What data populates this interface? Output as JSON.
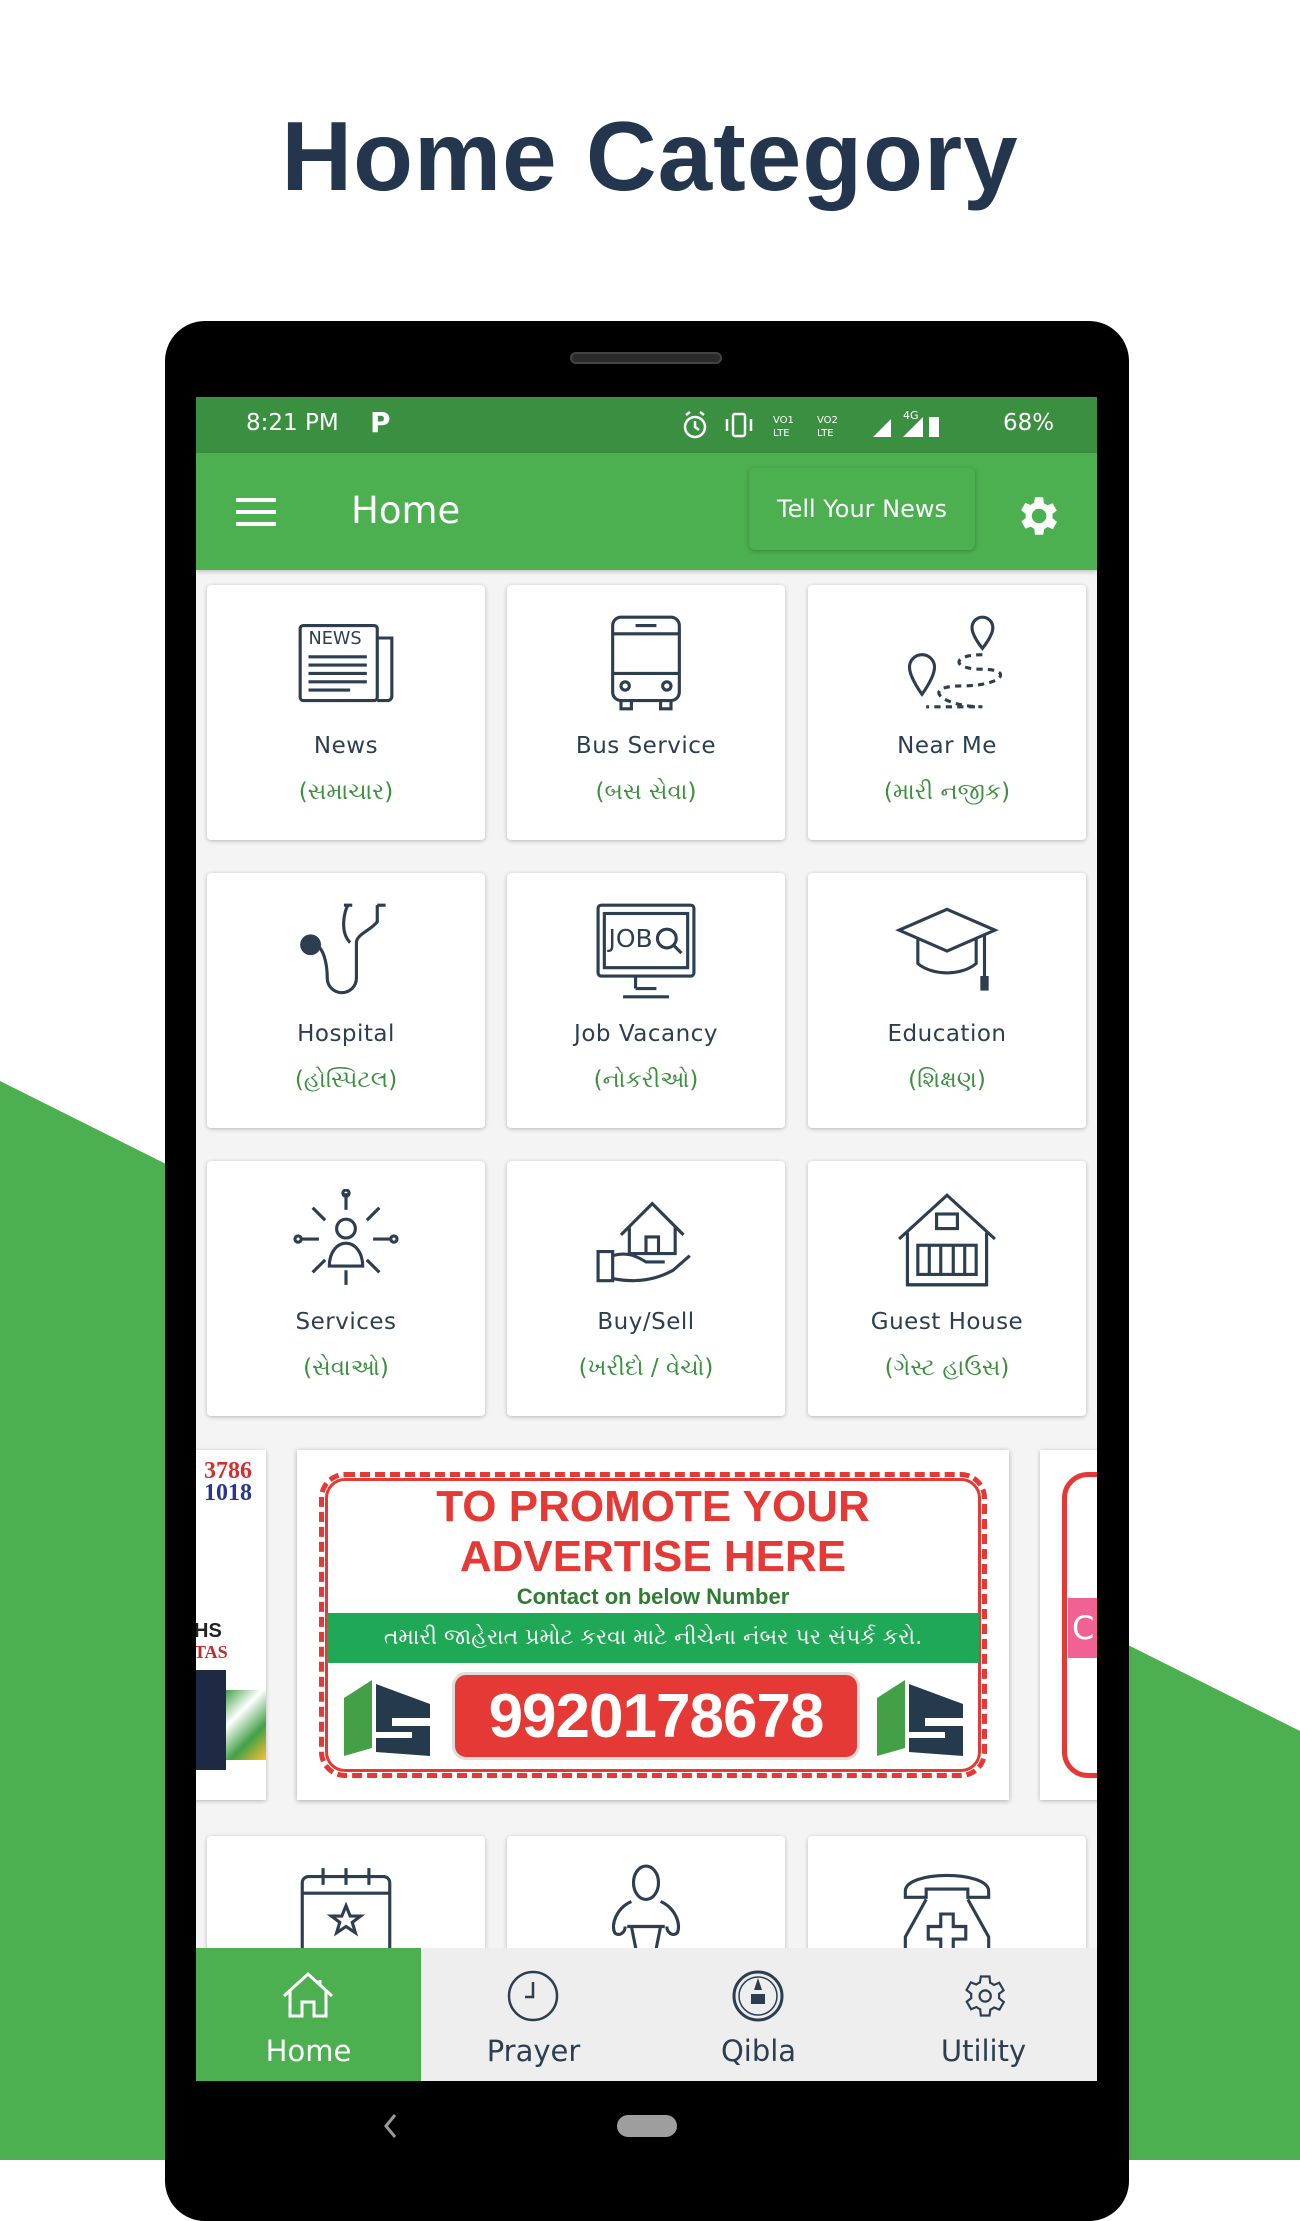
{
  "promo": {
    "title": "Home Category"
  },
  "colors": {
    "brand_green": "#4caf50",
    "status_green": "#3a8f41",
    "icon_dark": "#2c3e50",
    "guj_green": "#3c8f3f",
    "ad_red": "#e53935"
  },
  "status_bar": {
    "time": "8:21 PM",
    "app_icon": "p-icon",
    "icons": [
      "alarm-icon",
      "vibrate-icon",
      "volte1-icon",
      "volte2-icon",
      "signal-icon",
      "signal-4g-icon",
      "battery-icon"
    ],
    "network": "4G",
    "battery": "68%"
  },
  "app_bar": {
    "title": "Home",
    "tell_news_label": "Tell Your News",
    "menu_icon": "menu-icon",
    "settings_icon": "gear-icon"
  },
  "categories": [
    {
      "label": "News",
      "local": "(સમાચાર)",
      "icon": "newspaper"
    },
    {
      "label": "Bus Service",
      "local": "(બસ સેવા)",
      "icon": "bus"
    },
    {
      "label": "Near Me",
      "local": "(મારી નજીક)",
      "icon": "route-pin"
    },
    {
      "label": "Hospital",
      "local": "(હોસ્પિટલ)",
      "icon": "stethoscope"
    },
    {
      "label": "Job Vacancy",
      "local": "(નોકરીઓ)",
      "icon": "job-monitor"
    },
    {
      "label": "Education",
      "local": "(શિક્ષણ)",
      "icon": "graduation-cap"
    },
    {
      "label": "Services",
      "local": "(સેવાઓ)",
      "icon": "services-network"
    },
    {
      "label": "Buy/Sell",
      "local": "(ખરીદો / વેચો)",
      "icon": "house-hand"
    },
    {
      "label": "Guest House",
      "local": "(ગેસ્ટ હાઉસ)",
      "icon": "guest-house"
    },
    {
      "label": "",
      "local": "",
      "icon": "calendar-star"
    },
    {
      "label": "",
      "local": "",
      "icon": "baby"
    },
    {
      "label": "",
      "local": "",
      "icon": "medical-phone"
    }
  ],
  "ad_banner": {
    "headline_1": "TO PROMOTE YOUR",
    "headline_2": "ADVERTISE HERE",
    "contact_line": "Contact on below Number",
    "gujarati_line": "તમારી જાહેરાત પ્રમોટ કરવા માટે નીચેના નંબર પર સંપર્ક કરો.",
    "phone_number": "9920178678",
    "logo": "MS",
    "left_partial": {
      "line1": "3786",
      "line2": "1018",
      "line3": "HS",
      "line4": "TAS"
    },
    "right_partial": {
      "text": "C"
    }
  },
  "bottom_nav": [
    {
      "label": "Home",
      "icon": "home-icon",
      "active": true
    },
    {
      "label": "Prayer",
      "icon": "clock-icon",
      "active": false
    },
    {
      "label": "Qibla",
      "icon": "compass-icon",
      "active": false
    },
    {
      "label": "Utility",
      "icon": "gear-outline-icon",
      "active": false
    }
  ],
  "system_nav": {
    "back": "back-chevron-icon",
    "home": "home-pill"
  }
}
